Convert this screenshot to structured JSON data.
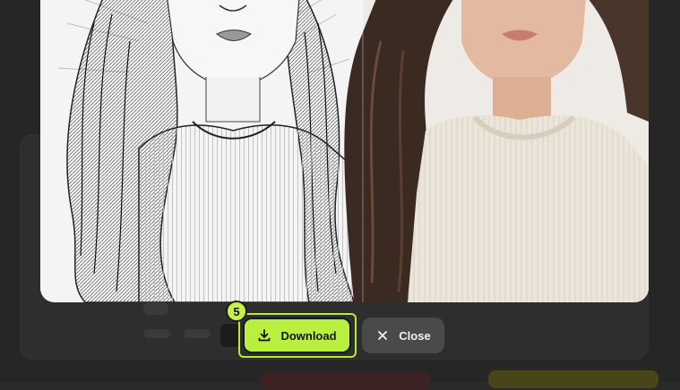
{
  "overlay": {
    "step_number": "5",
    "download_label": "Download",
    "close_label": "Close",
    "download_icon": "download-icon",
    "close_icon": "close-icon",
    "accent_color": "#b9f040"
  },
  "preview": {
    "left_style": "sketch",
    "right_style": "photo"
  }
}
